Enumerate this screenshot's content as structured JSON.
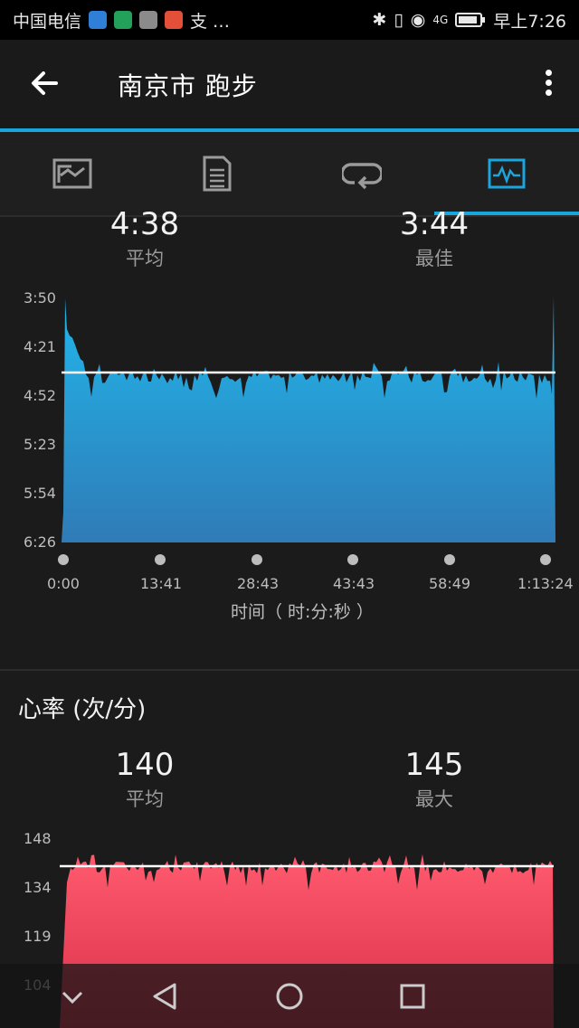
{
  "status_bar": {
    "carrier": "中国电信",
    "time": "早上7:26",
    "network": "4G",
    "colors": {
      "app1": "#2f7fd8",
      "app2": "#23a05a",
      "app3": "#8b8b8b",
      "app4": "#e44f3a"
    }
  },
  "header": {
    "title": "南京市 跑步"
  },
  "tabs": [
    {
      "icon": "map-stats-icon",
      "active": false
    },
    {
      "icon": "details-list-icon",
      "active": false
    },
    {
      "icon": "laps-loop-icon",
      "active": false
    },
    {
      "icon": "chart-icon",
      "active": true
    }
  ],
  "pace": {
    "avg_value": "4:38",
    "avg_label": "平均",
    "best_value": "3:44",
    "best_label": "最佳"
  },
  "heart_rate": {
    "title": "心率 (次/分)",
    "avg_value": "140",
    "avg_label": "平均",
    "max_value": "145",
    "max_label": "最大"
  },
  "chart_data": [
    {
      "type": "area",
      "yticks": [
        "3:50",
        "4:21",
        "4:52",
        "5:23",
        "5:54",
        "6:26"
      ],
      "xticks": [
        "0:00",
        "13:41",
        "28:43",
        "43:43",
        "58:49",
        "1:13:24"
      ],
      "xlabel": "时间（ 时:分:秒 ）",
      "y_inverted": true,
      "average_line": "4:38",
      "color_top": "#22b6ea",
      "color_bottom": "#2f7bb7"
    },
    {
      "type": "area",
      "yticks": [
        "148",
        "134",
        "119",
        "104"
      ],
      "average_line": "140",
      "color_top": "#ff5a6e",
      "color_bottom": "#d8304a"
    }
  ]
}
